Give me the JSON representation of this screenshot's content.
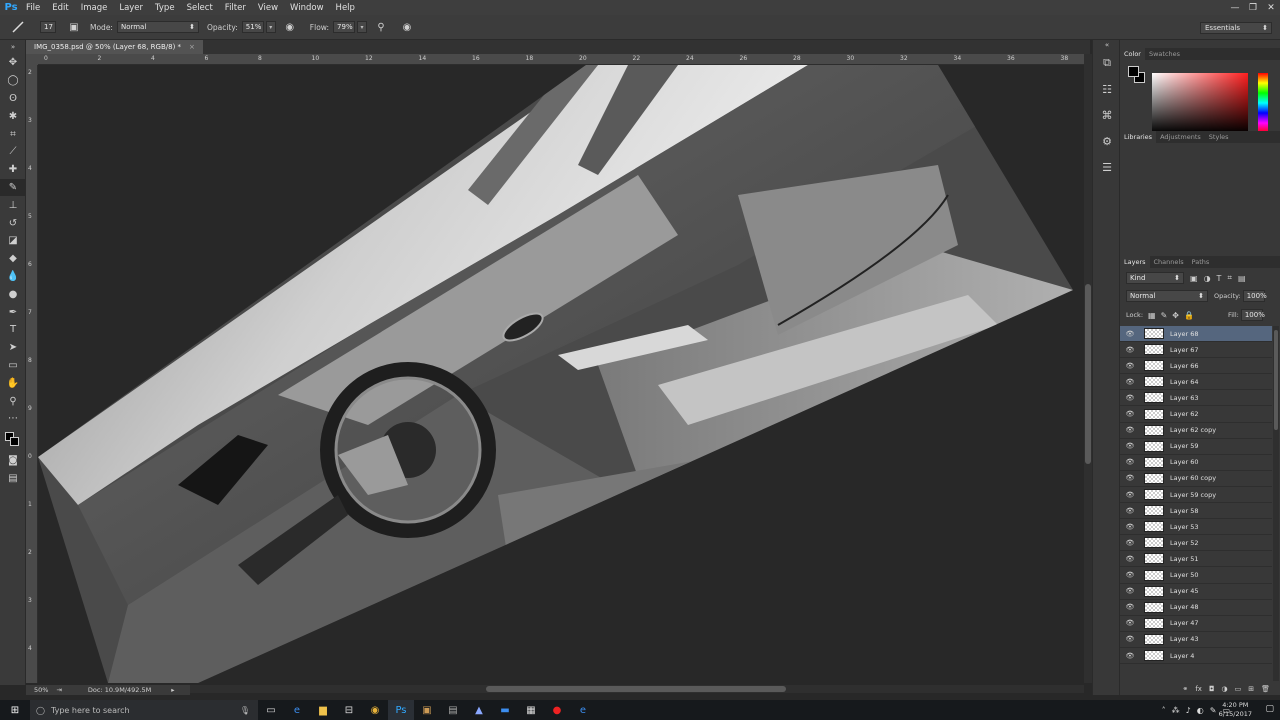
{
  "app": {
    "logo": "Ps"
  },
  "menu": [
    "File",
    "Edit",
    "Image",
    "Layer",
    "Type",
    "Select",
    "Filter",
    "View",
    "Window",
    "Help"
  ],
  "window_controls": [
    "—",
    "❐",
    "✕"
  ],
  "options": {
    "brush_size": "17",
    "mode_label": "Mode:",
    "mode_value": "Normal",
    "opacity_label": "Opacity:",
    "opacity_value": "51%",
    "flow_label": "Flow:",
    "flow_value": "79%",
    "workspace": "Essentials"
  },
  "document": {
    "tab_title": "IMG_0358.psd @ 50% (Layer 68, RGB/8) *",
    "close": "×",
    "zoom": "50%",
    "doc_size": "Doc: 10.9M/492.5M"
  },
  "rulers": {
    "h": [
      "0",
      "2",
      "4",
      "6",
      "8",
      "10",
      "12",
      "14",
      "16",
      "18",
      "20",
      "22",
      "24",
      "26",
      "28",
      "30",
      "32",
      "34",
      "36",
      "38"
    ],
    "v": [
      "2",
      "3",
      "4",
      "5",
      "6",
      "7",
      "8",
      "9",
      "0",
      "1",
      "2",
      "3",
      "4"
    ]
  },
  "panels": {
    "color_tabs": [
      "Color",
      "Swatches"
    ],
    "library_tabs": [
      "Libraries",
      "Adjustments",
      "Styles"
    ],
    "layer_tabs": [
      "Layers",
      "Channels",
      "Paths"
    ],
    "kind": "Kind",
    "blend_mode": "Normal",
    "opacity_label": "Opacity:",
    "opacity_value": "100%",
    "lock_label": "Lock:",
    "fill_label": "Fill:",
    "fill_value": "100%"
  },
  "layers": [
    {
      "name": "Layer 68",
      "selected": true
    },
    {
      "name": "Layer 67"
    },
    {
      "name": "Layer 66"
    },
    {
      "name": "Layer 64"
    },
    {
      "name": "Layer 63"
    },
    {
      "name": "Layer 62"
    },
    {
      "name": "Layer 62 copy"
    },
    {
      "name": "Layer 59"
    },
    {
      "name": "Layer 60"
    },
    {
      "name": "Layer 60 copy"
    },
    {
      "name": "Layer 59 copy"
    },
    {
      "name": "Layer 58"
    },
    {
      "name": "Layer 53"
    },
    {
      "name": "Layer 52"
    },
    {
      "name": "Layer 51"
    },
    {
      "name": "Layer 50"
    },
    {
      "name": "Layer 45"
    },
    {
      "name": "Layer 48"
    },
    {
      "name": "Layer 47"
    },
    {
      "name": "Layer 43"
    },
    {
      "name": "Layer 4"
    }
  ],
  "taskbar": {
    "search_placeholder": "Type here to search",
    "time": "4:20 PM",
    "date": "6/15/2017"
  }
}
